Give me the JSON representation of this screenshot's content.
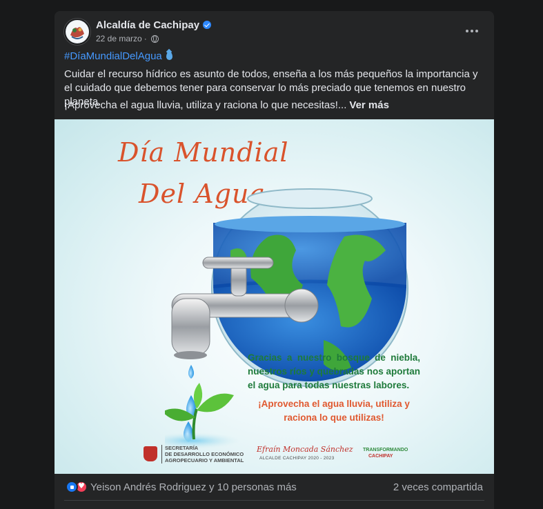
{
  "post": {
    "page_name": "Alcaldía de Cachipay",
    "date": "22 de marzo",
    "separator": "·",
    "hashtag": "#DíaMundialDelAgua",
    "caption_1": "Cuidar el recurso hídrico es asunto de todos, enseña a los más pequeños la importancia y el cuidado que debemos tener para conservar lo más preciado que tenemos en nuestro planeta.",
    "caption_2": "¡Aprovecha el agua lluvia, utiliza y raciona lo que necesitas!...",
    "see_more": "Ver más"
  },
  "image": {
    "title_line_1": "Día Mundial",
    "title_line_2": "Del Agua",
    "message_1": "Gracias a nuestro bosque de niebla, nuestros ríos y quebradas nos aportan el agua para todas nuestras labores.",
    "message_2": "¡Aprovecha el agua lluvia, utiliza y raciona lo que utilizas!",
    "secretaria": "SECRETARÍA\nDE DESARROLLO ECONÓMICO\nAGROPECUARIO Y AMBIENTAL",
    "alcalde_name": "Efraín Moncada Sánchez",
    "alcalde_sub": "ALCALDE CACHIPAY 2020 - 2023",
    "transformando_top": "TRANSFORMANDO",
    "transformando_bottom": "CACHIPAY"
  },
  "reactions": {
    "text": "Yeison Andrés Rodriguez y 10 personas más",
    "shares": "2 veces compartida"
  },
  "colors": {
    "background": "#18191a",
    "card": "#242526",
    "link": "#4599ff",
    "like": "#1877f2",
    "love": "#f33e58",
    "title_orange": "#d9532c",
    "message_green": "#1e7a3a"
  }
}
